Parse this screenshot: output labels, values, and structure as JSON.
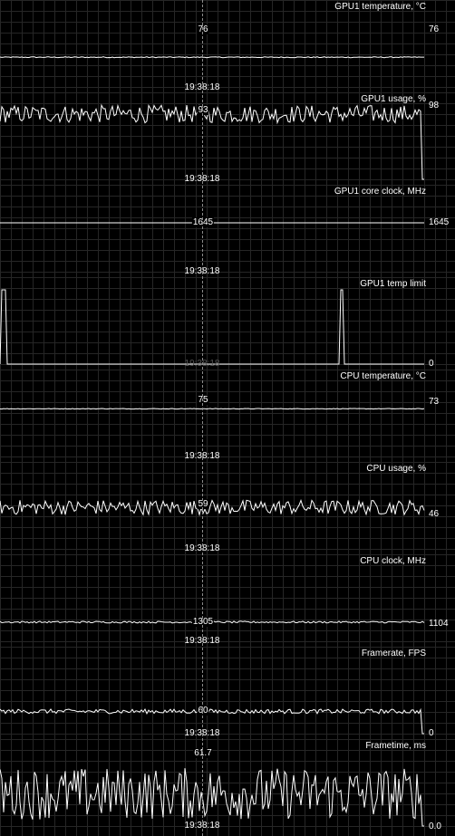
{
  "cursor_time": "19:38:18",
  "panels": [
    {
      "title": "GPU1 temperature, °C",
      "cursor_value": "76",
      "current_value": "76",
      "series": {
        "base": 76,
        "amp": 0.25,
        "spikes": [],
        "min": 60,
        "max": 100,
        "end_drop": false
      }
    },
    {
      "title": "GPU1 usage, %",
      "cursor_value": "93",
      "current_value": "98",
      "series": {
        "base": 88,
        "amp": 12,
        "spikes": [],
        "min": 0,
        "max": 100,
        "end_drop": true
      }
    },
    {
      "title": "GPU1 core clock, MHz",
      "cursor_value": "1645",
      "current_value": "1645",
      "series": {
        "base": 1645,
        "amp": 0,
        "spikes": [],
        "min": 0,
        "max": 2500,
        "end_drop": false
      }
    },
    {
      "title": "GPU1 temp limit",
      "cursor_value": "0",
      "current_value": "0",
      "series": {
        "base": 0,
        "amp": 0,
        "spikes": [
          4,
          377
        ],
        "min": 0,
        "max": 1,
        "end_drop": false
      }
    },
    {
      "title": "CPU temperature, °C",
      "cursor_value": "75",
      "current_value": "73",
      "series": {
        "base": 75,
        "amp": 0.3,
        "spikes": [],
        "min": 30,
        "max": 100,
        "end_drop": false
      }
    },
    {
      "title": "CPU usage, %",
      "cursor_value": "59",
      "current_value": "46",
      "series": {
        "base": 56,
        "amp": 10,
        "spikes": [],
        "min": 0,
        "max": 100,
        "end_drop": false
      }
    },
    {
      "title": "CPU clock, MHz",
      "cursor_value": "1305",
      "current_value": "1104",
      "series": {
        "base": 1290,
        "amp": 60,
        "spikes": [],
        "min": 0,
        "max": 5000,
        "end_drop": false
      }
    },
    {
      "title": "Framerate, FPS",
      "cursor_value": "60",
      "current_value": "0",
      "series": {
        "base": 60,
        "amp": 6,
        "spikes": [],
        "min": 0,
        "max": 200,
        "end_drop": true
      }
    },
    {
      "title": "Frametime, ms",
      "cursor_value": "61.7",
      "current_value": "0.0",
      "series": {
        "base": 35,
        "amp": 28,
        "spikes": [],
        "min": 0,
        "max": 80,
        "end_drop": true
      }
    }
  ]
}
